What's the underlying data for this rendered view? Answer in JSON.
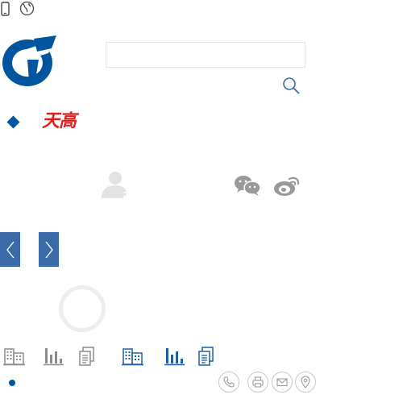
{
  "header": {
    "brand_text": "天高",
    "brand_colors": {
      "blue": "#00559f",
      "red": "#e31d1a"
    },
    "mobile_icon": "mobile-icon",
    "globe_icon": "globe-icon"
  },
  "search": {
    "value": "",
    "placeholder": "",
    "icon": "search-icon"
  },
  "menu": {
    "icon": "diamond-icon"
  },
  "user": {
    "icon": "add-user-icon"
  },
  "social": {
    "wechat_icon": "wechat-icon",
    "weibo_icon": "weibo-icon"
  },
  "carousel": {
    "prev_icon": "chevron-left-icon",
    "next_icon": "chevron-right-icon",
    "accent": "#3b6aa8"
  },
  "quicklinks": {
    "grey_set": [
      "building-icon",
      "bar-chart-icon",
      "document-icon"
    ],
    "blue_set": [
      "building-icon",
      "bar-chart-icon",
      "document-icon"
    ],
    "grey": "#8c8c8c",
    "blue": "#1f5fa7"
  },
  "footer": {
    "contact_icons": [
      "phone-icon",
      "fax-icon",
      "mail-icon",
      "location-icon"
    ],
    "dot_color": "#00559f"
  }
}
